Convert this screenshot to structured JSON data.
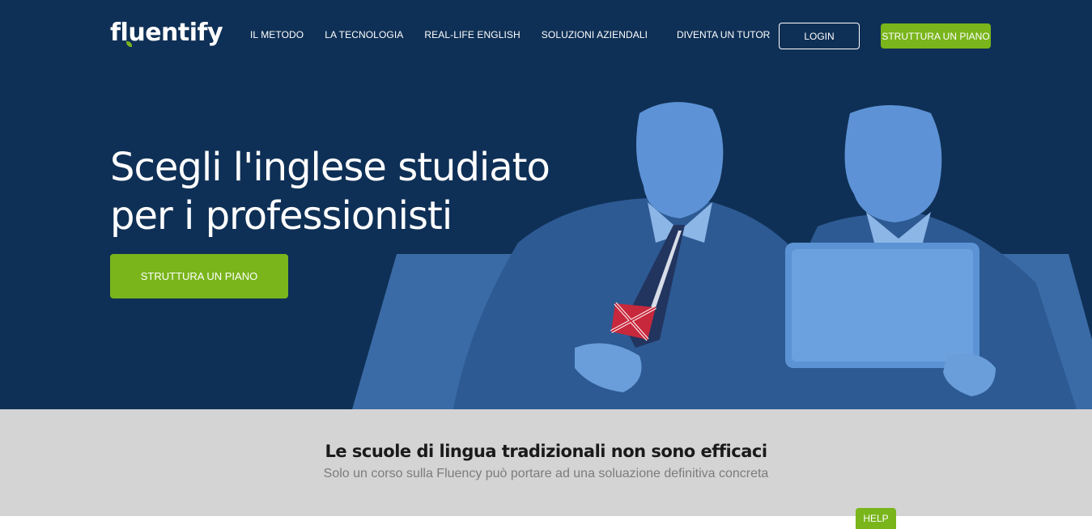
{
  "brand": {
    "logo_text": "fluentify",
    "accent_color": "#79b51b",
    "hero_bg": "#0f3056"
  },
  "nav": {
    "links": [
      "IL METODO",
      "LA TECNOLOGIA",
      "REAL-LIFE ENGLISH",
      "SOLUZIONI AZIENDALI"
    ],
    "tutor": "DIVENTA UN TUTOR",
    "login": "LOGIN",
    "cta": "STRUTTURA UN PIANO"
  },
  "hero": {
    "title_line1": "Scegli l'inglese studiato",
    "title_line2": "per i professionisti",
    "cta": "STRUTTURA UN PIANO",
    "image_icon": "two-businessmen-uk-flag-tie-image"
  },
  "band": {
    "title": "Le scuole di lingua tradizionali non sono efficaci",
    "subtitle": "Solo un corso sulla Fluency può portare ad una soluazione definitiva concreta"
  },
  "help": {
    "label": "HELP"
  }
}
